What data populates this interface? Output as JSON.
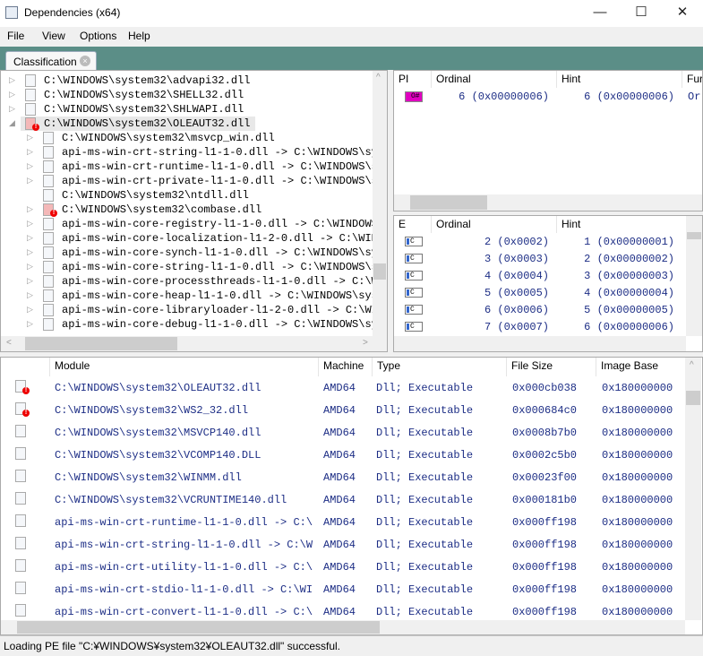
{
  "window": {
    "title": "Dependencies (x64)",
    "minimize": "—",
    "maximize": "☐",
    "close": "✕"
  },
  "menu": [
    "File",
    "View",
    "Options",
    "Help"
  ],
  "tab": {
    "label": "Classification",
    "close": "×"
  },
  "tree": [
    {
      "text": "C:\\WINDOWS\\system32\\advapi32.dll",
      "level": 0,
      "expand": "▷",
      "error": false
    },
    {
      "text": "C:\\WINDOWS\\system32\\SHELL32.dll",
      "level": 0,
      "expand": "▷",
      "error": false
    },
    {
      "text": "C:\\WINDOWS\\system32\\SHLWAPI.dll",
      "level": 0,
      "expand": "▷",
      "error": false
    },
    {
      "text": "C:\\WINDOWS\\system32\\OLEAUT32.dll",
      "level": 0,
      "expand": "◢",
      "error": true,
      "selected": true
    },
    {
      "text": "C:\\WINDOWS\\system32\\msvcp_win.dll",
      "level": 1,
      "expand": "▷",
      "error": false
    },
    {
      "text": "api-ms-win-crt-string-l1-1-0.dll -> C:\\WINDOWS\\sy",
      "level": 1,
      "expand": "▷",
      "error": false
    },
    {
      "text": "api-ms-win-crt-runtime-l1-1-0.dll -> C:\\WINDOWS\\s",
      "level": 1,
      "expand": "▷",
      "error": false
    },
    {
      "text": "api-ms-win-crt-private-l1-1-0.dll -> C:\\WINDOWS\\s",
      "level": 1,
      "expand": "▷",
      "error": false
    },
    {
      "text": "C:\\WINDOWS\\system32\\ntdll.dll",
      "level": 1,
      "expand": "",
      "error": false
    },
    {
      "text": "C:\\WINDOWS\\system32\\combase.dll",
      "level": 1,
      "expand": "▷",
      "error": true
    },
    {
      "text": "api-ms-win-core-registry-l1-1-0.dll -> C:\\WINDOWS",
      "level": 1,
      "expand": "▷",
      "error": false
    },
    {
      "text": "api-ms-win-core-localization-l1-2-0.dll -> C:\\WIN",
      "level": 1,
      "expand": "▷",
      "error": false
    },
    {
      "text": "api-ms-win-core-synch-l1-1-0.dll -> C:\\WINDOWS\\sy",
      "level": 1,
      "expand": "▷",
      "error": false
    },
    {
      "text": "api-ms-win-core-string-l1-1-0.dll -> C:\\WINDOWS\\s",
      "level": 1,
      "expand": "▷",
      "error": false
    },
    {
      "text": "api-ms-win-core-processthreads-l1-1-0.dll -> C:\\W",
      "level": 1,
      "expand": "▷",
      "error": false
    },
    {
      "text": "api-ms-win-core-heap-l1-1-0.dll -> C:\\WINDOWS\\sys",
      "level": 1,
      "expand": "▷",
      "error": false
    },
    {
      "text": "api-ms-win-core-libraryloader-l1-2-0.dll -> C:\\WI",
      "level": 1,
      "expand": "▷",
      "error": false
    },
    {
      "text": "api-ms-win-core-debug-l1-1-0.dll -> C:\\WINDOWS\\sy",
      "level": 1,
      "expand": "▷",
      "error": false
    }
  ],
  "imports": {
    "headers": [
      "PI",
      "Ordinal",
      "Hint",
      "Fur"
    ],
    "rows": [
      {
        "icon": "O#",
        "ordinal": "6 (0x00000006)",
        "hint": "6 (0x00000006)",
        "func": "Or"
      }
    ]
  },
  "exports": {
    "headers": [
      "E",
      "Ordinal",
      "Hint"
    ],
    "rows": [
      {
        "icon": "C",
        "ordinal": "2 (0x0002)",
        "hint": "1 (0x00000001)"
      },
      {
        "icon": "C",
        "ordinal": "3 (0x0003)",
        "hint": "2 (0x00000002)"
      },
      {
        "icon": "C",
        "ordinal": "4 (0x0004)",
        "hint": "3 (0x00000003)"
      },
      {
        "icon": "C",
        "ordinal": "5 (0x0005)",
        "hint": "4 (0x00000004)"
      },
      {
        "icon": "C",
        "ordinal": "6 (0x0006)",
        "hint": "5 (0x00000005)"
      },
      {
        "icon": "C",
        "ordinal": "7 (0x0007)",
        "hint": "6 (0x00000006)"
      }
    ]
  },
  "modules": {
    "headers": [
      "",
      "Module",
      "Machine",
      "Type",
      "File Size",
      "Image Base"
    ],
    "rows": [
      {
        "error": true,
        "module": "C:\\WINDOWS\\system32\\OLEAUT32.dll",
        "machine": "AMD64",
        "type": "Dll; Executable",
        "size": "0x000cb038",
        "base": "0x180000000"
      },
      {
        "error": true,
        "module": "C:\\WINDOWS\\system32\\WS2_32.dll",
        "machine": "AMD64",
        "type": "Dll; Executable",
        "size": "0x000684c0",
        "base": "0x180000000"
      },
      {
        "error": false,
        "module": "C:\\WINDOWS\\system32\\MSVCP140.dll",
        "machine": "AMD64",
        "type": "Dll; Executable",
        "size": "0x0008b7b0",
        "base": "0x180000000"
      },
      {
        "error": false,
        "module": "C:\\WINDOWS\\system32\\VCOMP140.DLL",
        "machine": "AMD64",
        "type": "Dll; Executable",
        "size": "0x0002c5b0",
        "base": "0x180000000"
      },
      {
        "error": false,
        "module": "C:\\WINDOWS\\system32\\WINMM.dll",
        "machine": "AMD64",
        "type": "Dll; Executable",
        "size": "0x00023f00",
        "base": "0x180000000"
      },
      {
        "error": false,
        "module": "C:\\WINDOWS\\system32\\VCRUNTIME140.dll",
        "machine": "AMD64",
        "type": "Dll; Executable",
        "size": "0x000181b0",
        "base": "0x180000000"
      },
      {
        "error": false,
        "module": "api-ms-win-crt-runtime-l1-1-0.dll -> C:\\",
        "machine": "AMD64",
        "type": "Dll; Executable",
        "size": "0x000ff198",
        "base": "0x180000000"
      },
      {
        "error": false,
        "module": "api-ms-win-crt-string-l1-1-0.dll -> C:\\W",
        "machine": "AMD64",
        "type": "Dll; Executable",
        "size": "0x000ff198",
        "base": "0x180000000"
      },
      {
        "error": false,
        "module": "api-ms-win-crt-utility-l1-1-0.dll -> C:\\",
        "machine": "AMD64",
        "type": "Dll; Executable",
        "size": "0x000ff198",
        "base": "0x180000000"
      },
      {
        "error": false,
        "module": "api-ms-win-crt-stdio-l1-1-0.dll -> C:\\WI",
        "machine": "AMD64",
        "type": "Dll; Executable",
        "size": "0x000ff198",
        "base": "0x180000000"
      },
      {
        "error": false,
        "module": "api-ms-win-crt-convert-l1-1-0.dll -> C:\\",
        "machine": "AMD64",
        "type": "Dll; Executable",
        "size": "0x000ff198",
        "base": "0x180000000"
      }
    ]
  },
  "status": "Loading PE file \"C:¥WINDOWS¥system32¥OLEAUT32.dll\" successful.",
  "colors": {
    "band": "#5b8e87",
    "text_blue": "#1c2d85",
    "error": "#e00000",
    "import_icon": "#e000c0"
  }
}
